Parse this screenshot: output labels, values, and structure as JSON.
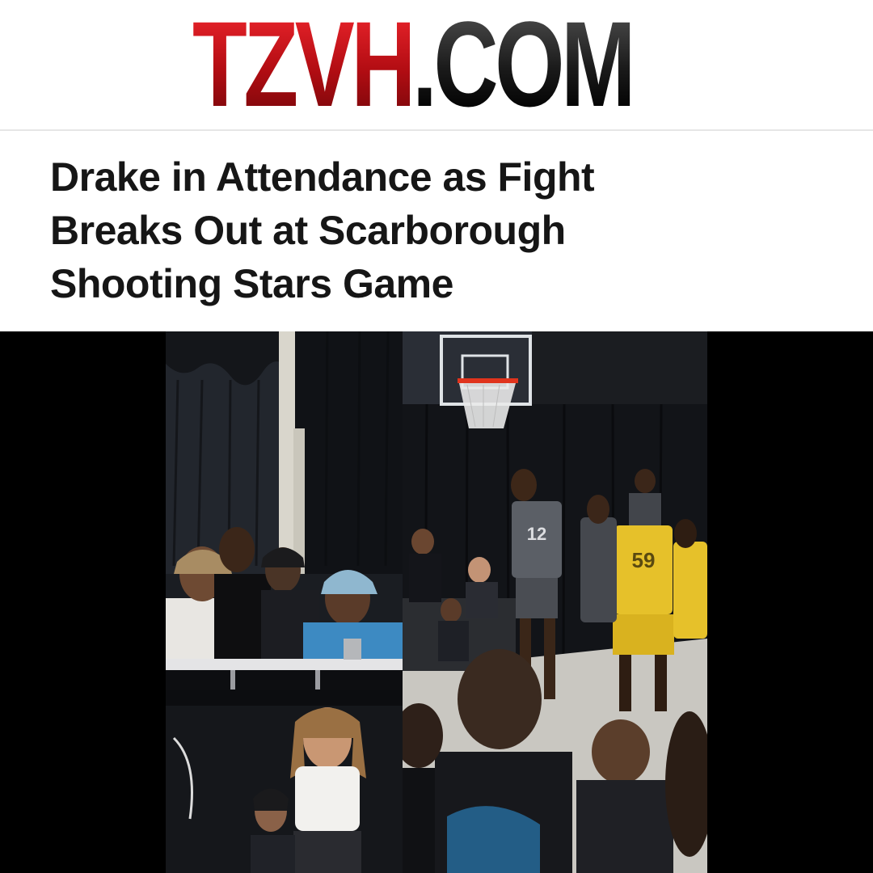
{
  "site": {
    "logo_primary": "TZVH",
    "logo_suffix": ".COM",
    "logo_primary_color": "#c8141c",
    "logo_suffix_color": "#1c1c1c"
  },
  "article": {
    "headline_lines": [
      "Drake in Attendance as Fight",
      "Breaks Out at Scarborough",
      "Shooting Stars Game"
    ]
  },
  "collage": {
    "background": "#000000",
    "panels": [
      "courtside-spectators-photo",
      "spectator-woman-photo",
      "basketball-fight-photo"
    ],
    "jersey_numbers": [
      "12",
      "59"
    ],
    "team_colors": {
      "home": "#e6c12a",
      "away": "#5b5f66"
    }
  }
}
